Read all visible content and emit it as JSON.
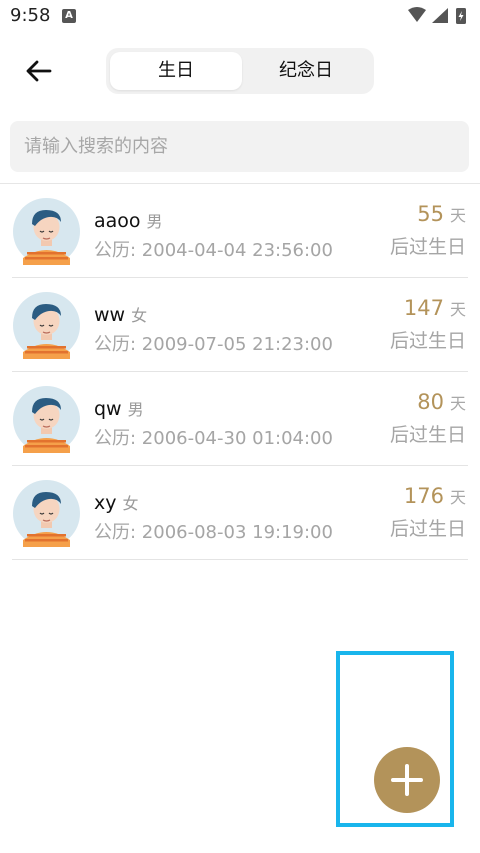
{
  "status_bar": {
    "time": "9:58",
    "notification_icon_letter": "A"
  },
  "header": {
    "tabs": [
      {
        "label": "生日",
        "active": true
      },
      {
        "label": "纪念日",
        "active": false
      }
    ]
  },
  "search": {
    "placeholder": "请输入搜索的内容",
    "value": ""
  },
  "list": [
    {
      "name": "aaoo",
      "gender": "男",
      "date": "公历: 2004-04-04 23:56:00",
      "days": "55",
      "unit": "天",
      "suffix": "后过生日"
    },
    {
      "name": "ww",
      "gender": "女",
      "date": "公历: 2009-07-05 21:23:00",
      "days": "147",
      "unit": "天",
      "suffix": "后过生日"
    },
    {
      "name": "qw",
      "gender": "男",
      "date": "公历: 2006-04-30 01:04:00",
      "days": "80",
      "unit": "天",
      "suffix": "后过生日"
    },
    {
      "name": "xy",
      "gender": "女",
      "date": "公历: 2006-08-03 19:19:00",
      "days": "176",
      "unit": "天",
      "suffix": "后过生日"
    }
  ],
  "colors": {
    "accent": "#b3935a",
    "highlight": "#19b5ec"
  },
  "icons": {
    "back": "arrow-left-icon",
    "fab": "plus-icon",
    "avatar": "person-avatar-icon"
  }
}
